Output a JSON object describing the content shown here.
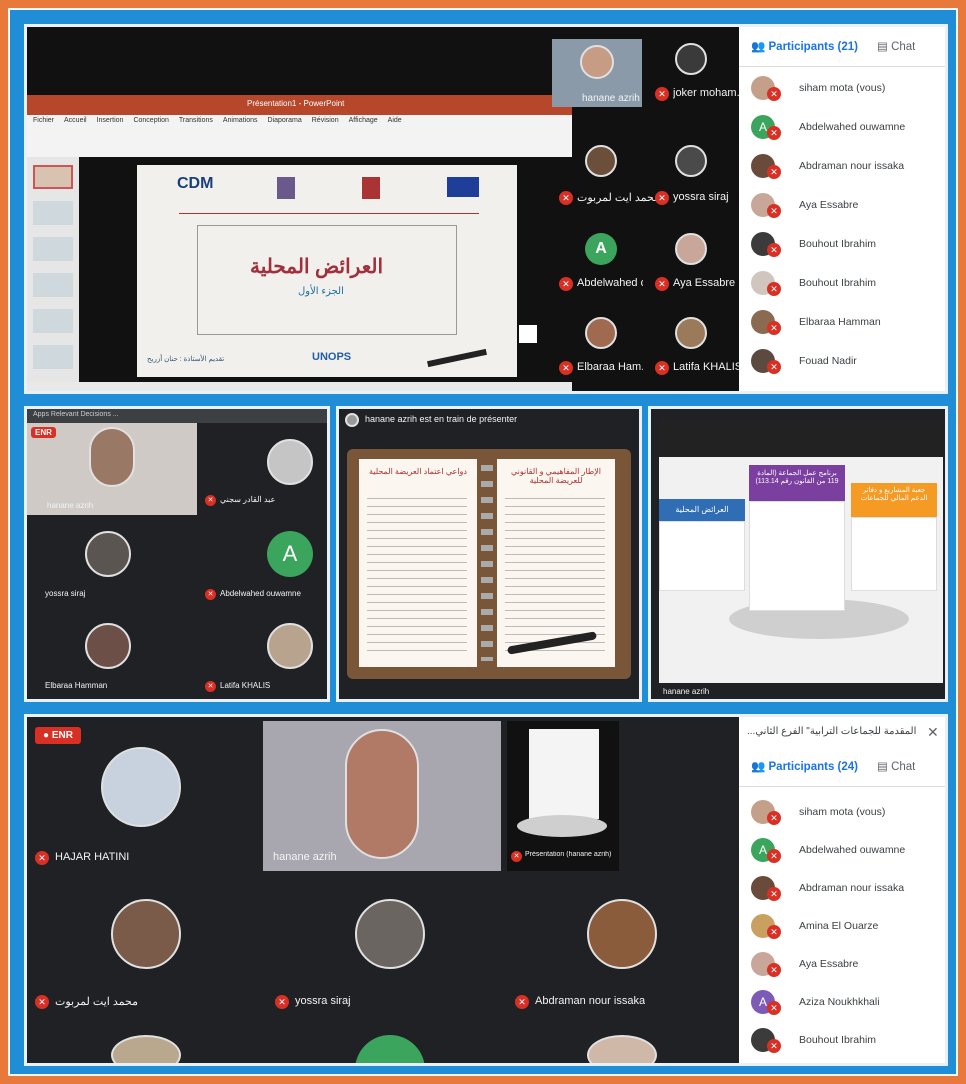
{
  "top": {
    "ribbon_title": "Présentation1 - PowerPoint",
    "ribbon_tabs": [
      "Fichier",
      "Accueil",
      "Insertion",
      "Conception",
      "Transitions",
      "Animations",
      "Diaporama",
      "Révision",
      "Affichage",
      "Aide"
    ],
    "slide": {
      "logo_cdm": "CDM",
      "title_ar": "العرائض المحلية",
      "subtitle_ar": "الجزء الأول",
      "footer_left": "تقديم الأستاذة : حنان أزريح",
      "footer_brand": "UNOPS"
    },
    "participants_tab": "Participants (21)",
    "chat_tab": "Chat",
    "tiles": [
      {
        "name": "hanane azrih"
      },
      {
        "name": "joker moham..."
      },
      {
        "name": "محمد ايت لمربوت"
      },
      {
        "name": "yossra siraj"
      },
      {
        "name": "Abdelwahed o...",
        "initial": "A"
      },
      {
        "name": "Aya Essabre"
      },
      {
        "name": "Elbaraa Ham..."
      },
      {
        "name": "Latifa KHALIS"
      }
    ],
    "participants": [
      "siham mota (vous)",
      "Abdelwahed ouwamne",
      "Abdraman nour issaka",
      "Aya Essabre",
      "Bouhout Ibrahim",
      "Bouhout Ibrahim",
      "Elbaraa Hamman",
      "Fouad Nadir"
    ]
  },
  "middle_left": {
    "enr": "ENR",
    "tabs_bar": "Apps  Relevant Decisions  ...",
    "tiles": [
      {
        "name": "hanane azrih"
      },
      {
        "name": "عبد القادر سجني"
      },
      {
        "name": "yossra siraj"
      },
      {
        "name": "Abdelwahed ouwamne",
        "initial": "A"
      },
      {
        "name": "Elbaraa Hamman"
      },
      {
        "name": "Latifa KHALIS"
      }
    ]
  },
  "middle_center": {
    "presenting": "hanane azrih est en train de présenter",
    "left_page_title": "الإطار المفاهيمي و القانوني للعريضة المحلية",
    "right_page_title": "دواعي اعتماد العريضة المحلية"
  },
  "middle_right": {
    "card_left": "العرائض المحلية",
    "card_center": "برنامج عمل الجماعة (المادة 119 من القانون رقم 113.14)",
    "card_right": "جعبة المشاريع و دفاتر الدعم المالي للجماعات",
    "caption": "hanane azrih"
  },
  "bottom": {
    "enr": "ENR",
    "header_title": "...المحطة المقدمة للجماعات الترابية\" الفرع الثاني",
    "participants_tab": "Participants (24)",
    "chat_tab": "Chat",
    "tiles": [
      {
        "name": "HAJAR HATINI"
      },
      {
        "name": "hanane azrih"
      },
      {
        "name": "Présentation (hanane azrih)"
      },
      {
        "name": "محمد ايت لمربوت"
      },
      {
        "name": "yossra siraj"
      },
      {
        "name": "Abdraman nour issaka"
      }
    ],
    "participants": [
      {
        "name": "siham mota (vous)"
      },
      {
        "name": "Abdelwahed ouwamne",
        "initial": "A"
      },
      {
        "name": "Abdraman nour issaka"
      },
      {
        "name": "Amina El Ouarze"
      },
      {
        "name": "Aya Essabre"
      },
      {
        "name": "Aziza Noukhkhali",
        "initial": "A"
      },
      {
        "name": "Bouhout Ibrahim"
      }
    ]
  },
  "colors": {
    "background": "#e8793a",
    "frame": "#1f8ed6",
    "meet_dark": "#202124",
    "mic_red": "#d93025",
    "accent": "#1a73e8"
  }
}
